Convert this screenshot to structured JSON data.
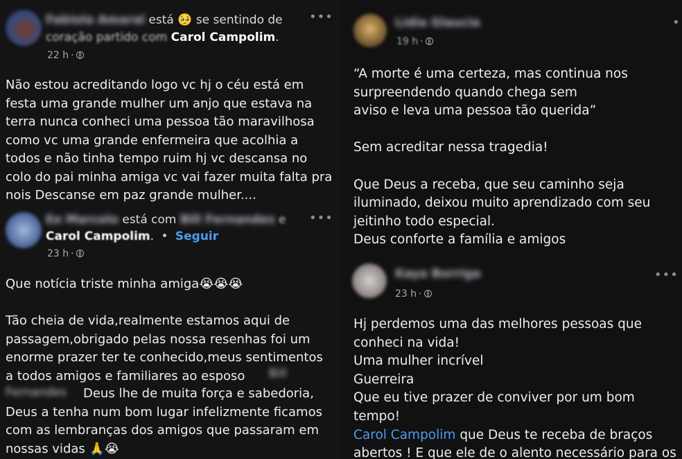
{
  "left_column": {
    "post1": {
      "verb": "está",
      "feeling_emoji": "🥺",
      "feeling_text": "se sentindo de",
      "feeling_text_2": "coração partido com",
      "tagged": "Carol Campolim",
      "time": "22 h",
      "more": "•••",
      "body": "Não estou acreditando logo vc hj o céu está em\nfesta uma grande mulher um anjo que estava na\nterra nunca conheci uma pessoa tão maravilhosa\ncomo vc uma grande enfermeira que acolhia a\ntodos e não tinha tempo ruim hj vc descansa no\ncolo do pai minha amiga vc vai fazer muita falta pra\nnois Descanse em paz grande mulher...."
    },
    "post2": {
      "verb": "está com",
      "conj": "e",
      "tagged": "Carol Campolim",
      "dot": "•",
      "follow": "Seguir",
      "time": "23 h",
      "more": "•••",
      "line1": "Que notícia triste minha amiga😭😭😭",
      "body": "Tão cheia de vida,realmente estamos aqui de\npassagem,obrigado pelas nossa resenhas foi um\nenorme prazer ter te conhecido,meus sentimentos\na todos amigos e familiares ao esposo",
      "body2": "Deus lhe de muita força e sabedoria,\nDeus a tenha num bom lugar infelizmente ficamos\ncom as lembranças dos amigos que passaram em\nnossas vidas 🙏😭"
    }
  },
  "right_column": {
    "post3": {
      "time": "19 h",
      "more": "•••",
      "body": "“A morte é uma certeza, mas continua nos\nsurpreendendo quando chega sem\naviso e leva uma pessoa tão querida”\n\nSem acreditar nessa tragedia!\n\nQue Deus a receba, que seu caminho seja\niluminado, deixou muito aprendizado com seu\njeitinho todo especial.\nDeus conforte a família e amigos"
    },
    "post4": {
      "time": "23 h",
      "more": "•••",
      "body": "Hj perdemos uma das melhores pessoas que\nconheci na vida!\nUma mulher incrível\nGuerreira\nQue eu tive prazer de conviver por um bom tempo!",
      "mention": "Carol Campolim",
      "body_tail": " que Deus te receba de braços\nabertos ! E que ele de o alento necessário para os\nseus !"
    }
  }
}
